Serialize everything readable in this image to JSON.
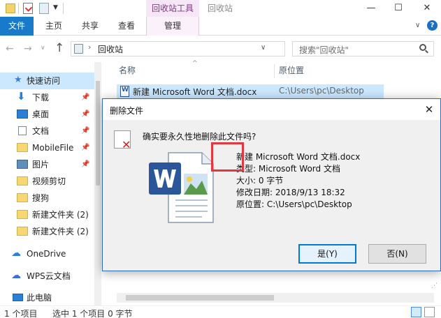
{
  "titlebar": {
    "context_tab_header": "回收站工具",
    "window_title": "回收站",
    "minimize": "—",
    "maximize": "☐",
    "close": "✕",
    "qa_dropdown": "▼"
  },
  "ribbon": {
    "tabs": [
      "文件",
      "主页",
      "共享",
      "查看",
      "管理"
    ],
    "collapse_glyph": "∨",
    "help_glyph": "?"
  },
  "address": {
    "back": "←",
    "forward": "→",
    "history": "∨",
    "up": "↑",
    "chevron": "›",
    "path": "回收站",
    "dropdown": "∨",
    "refresh": "↻"
  },
  "search": {
    "placeholder": "搜索\"回收站\""
  },
  "navpane": {
    "items": [
      {
        "label": "快速访问",
        "icon": "star-icon",
        "pinned": false
      },
      {
        "label": "下载",
        "icon": "download-icon",
        "pinned": true
      },
      {
        "label": "桌面",
        "icon": "desktop-icon",
        "pinned": true
      },
      {
        "label": "文档",
        "icon": "document-icon",
        "pinned": true
      },
      {
        "label": "MobileFile",
        "icon": "folder-icon",
        "pinned": true
      },
      {
        "label": "图片",
        "icon": "picture-icon",
        "pinned": true
      },
      {
        "label": "视频剪切",
        "icon": "folder-icon",
        "pinned": false
      },
      {
        "label": "搜狗",
        "icon": "folder-icon",
        "pinned": false
      },
      {
        "label": "新建文件夹 (2)",
        "icon": "folder-icon",
        "pinned": false
      },
      {
        "label": "新建文件夹 (2)",
        "icon": "folder-icon",
        "pinned": false
      },
      {
        "label": "OneDrive",
        "icon": "cloud-icon",
        "pinned": false
      },
      {
        "label": "WPS云文档",
        "icon": "cloud-icon",
        "pinned": false
      },
      {
        "label": "此电脑",
        "icon": "computer-icon",
        "pinned": false
      }
    ],
    "pin_glyph": "📌"
  },
  "filelist": {
    "columns": {
      "name": "名称",
      "origin": "原位置"
    },
    "sort_arrow": "^",
    "rows": [
      {
        "name": "新建 Microsoft Word 文档.docx",
        "origin": "C:\\Users\\pc\\Desktop"
      }
    ]
  },
  "status": {
    "count": "1 个项目",
    "selected": "选中 1 个项目  0 字节"
  },
  "dialog": {
    "title": "删除文件",
    "close": "✕",
    "question": "确实要永久性地删除此文件吗?",
    "x_glyph": "✕",
    "info": {
      "filename": "新建 Microsoft Word 文档.docx",
      "type": "类型: Microsoft Word 文档",
      "size": "大小: 0 字节",
      "date": "修改日期: 2018/9/13 18:32",
      "origin": "原位置: C:\\Users\\pc\\Desktop"
    },
    "yes_label": "是(Y)",
    "no_label": "否(N)",
    "grip": "⋰"
  },
  "colors": {
    "accent": "#1979ca",
    "selection": "#cce8ff",
    "highlight_box": "#e3383f",
    "context_tab": "#7a3b7a"
  }
}
